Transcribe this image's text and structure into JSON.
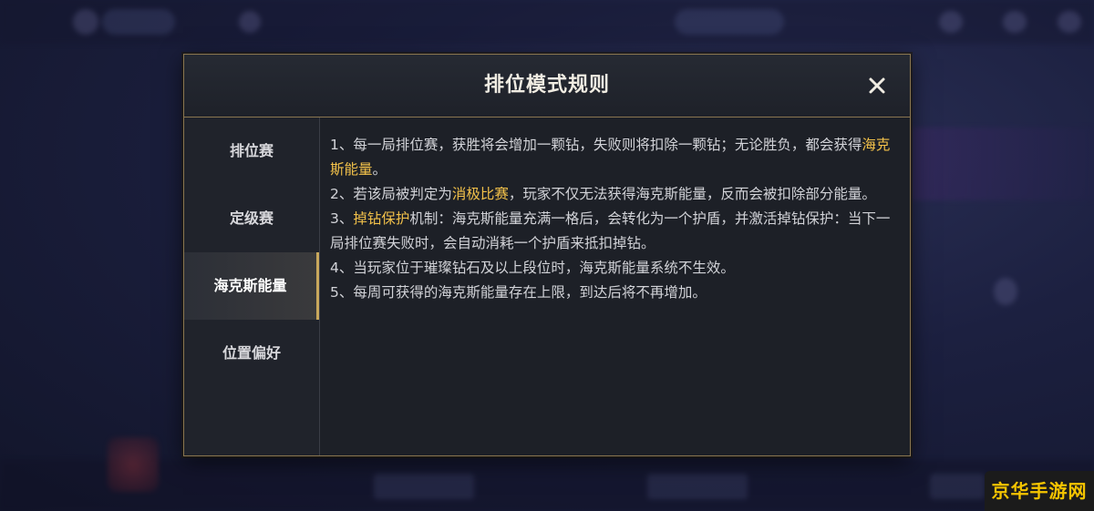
{
  "modal": {
    "title": "排位模式规则"
  },
  "sidebar": {
    "tabs": [
      {
        "label": "排位赛",
        "active": false
      },
      {
        "label": "定级赛",
        "active": false
      },
      {
        "label": "海克斯能量",
        "active": true
      },
      {
        "label": "位置偏好",
        "active": false
      }
    ]
  },
  "rules": [
    {
      "segments": [
        {
          "text": "1、每一局排位赛，获胜将会增加一颗钻，失败则将扣除一颗钻；无论胜负，都会获得",
          "highlight": false
        },
        {
          "text": "海克斯能量",
          "highlight": true
        },
        {
          "text": "。",
          "highlight": false
        }
      ]
    },
    {
      "segments": [
        {
          "text": "2、若该局被判定为",
          "highlight": false
        },
        {
          "text": "消极比赛",
          "highlight": true
        },
        {
          "text": "，玩家不仅无法获得海克斯能量，反而会被扣除部分能量。",
          "highlight": false
        }
      ]
    },
    {
      "segments": [
        {
          "text": "3、",
          "highlight": false
        },
        {
          "text": "掉钻保护",
          "highlight": true
        },
        {
          "text": "机制：海克斯能量充满一格后，会转化为一个护盾，并激活掉钻保护：当下一局排位赛失败时，会自动消耗一个护盾来抵扣掉钻。",
          "highlight": false
        }
      ]
    },
    {
      "segments": [
        {
          "text": "4、当玩家位于璀璨钻石及以上段位时，海克斯能量系统不生效。",
          "highlight": false
        }
      ]
    },
    {
      "segments": [
        {
          "text": "5、每周可获得的海克斯能量存在上限，到达后将不再增加。",
          "highlight": false
        }
      ]
    }
  ],
  "watermark": {
    "text": "京华手游网"
  },
  "icons": {
    "close": "close-icon"
  },
  "colors": {
    "highlight": "#f2c14a",
    "border": "#8a7650",
    "watermark": "#f5c400"
  }
}
